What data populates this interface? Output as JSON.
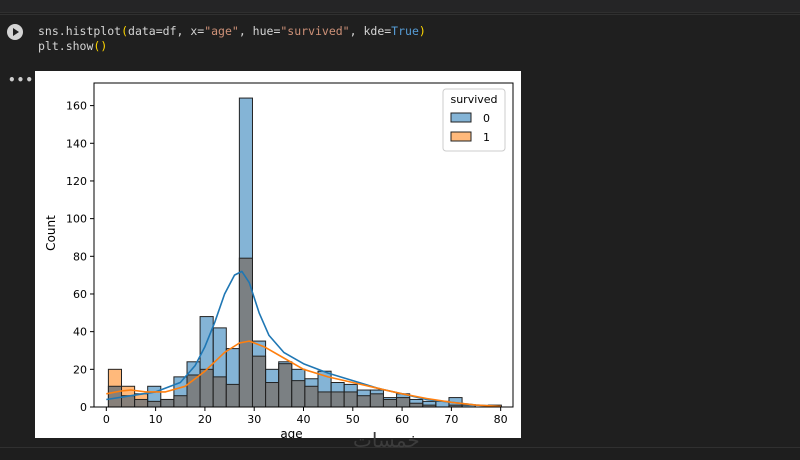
{
  "code": {
    "line1": {
      "fn": "sns.histplot",
      "open": "(",
      "a1": "data=df, x=",
      "s1": "\"age\"",
      "a2": ", hue=",
      "s2": "\"survived\"",
      "a3": ", kde=",
      "kw": "True",
      "close": ")"
    },
    "line2": {
      "fn": "plt.show",
      "parens": "()"
    }
  },
  "output_menu": "•••",
  "watermark": "خمسات",
  "chart_data": {
    "type": "histogram",
    "xlabel": "age",
    "ylabel": "Count",
    "xlim": [
      -2.5,
      82.5
    ],
    "ylim": [
      0,
      172
    ],
    "xticks": [
      0,
      10,
      20,
      30,
      40,
      50,
      60,
      70,
      80
    ],
    "yticks": [
      0,
      20,
      40,
      60,
      80,
      100,
      120,
      140,
      160
    ],
    "bin_edges": [
      0.42,
      3.08,
      5.74,
      8.39,
      11.05,
      13.71,
      16.37,
      19.02,
      21.68,
      24.34,
      26.99,
      29.65,
      32.31,
      34.97,
      37.62,
      40.28,
      42.94,
      45.6,
      48.25,
      50.91,
      53.57,
      56.22,
      58.88,
      61.54,
      64.2,
      66.85,
      69.51,
      72.17,
      74.83,
      77.48,
      80.14
    ],
    "legend": {
      "title": "survived",
      "placement": "top-right",
      "entries": [
        "0",
        "1"
      ]
    },
    "colors": {
      "0": "#1f77b4",
      "1": "#ff7f0e",
      "overlap": "#7a7a7a"
    },
    "series": [
      {
        "name": "0",
        "values": [
          11,
          6,
          4,
          11,
          4,
          16,
          24,
          48,
          42,
          31,
          164,
          35,
          20,
          24,
          20,
          15,
          19,
          13,
          12,
          9,
          9,
          5,
          7,
          4,
          3,
          3,
          5,
          1,
          0,
          0
        ]
      },
      {
        "name": "1",
        "values": [
          20,
          11,
          7,
          3,
          4,
          6,
          17,
          20,
          16,
          12,
          79,
          27,
          13,
          23,
          14,
          11,
          8,
          8,
          8,
          6,
          7,
          4,
          5,
          2,
          1,
          0,
          1,
          0,
          0,
          1
        ]
      }
    ],
    "kde": [
      {
        "name": "0",
        "x": [
          0,
          5,
          10,
          15,
          18,
          20,
          22,
          24,
          26,
          27.5,
          29,
          31,
          33,
          36,
          40,
          45,
          50,
          55,
          60,
          65,
          70,
          75,
          80
        ],
        "y": [
          4,
          6,
          8,
          13,
          22,
          32,
          45,
          60,
          70,
          72,
          66,
          50,
          38,
          29,
          23,
          18,
          14,
          10,
          7,
          4,
          2.5,
          1,
          0.3
        ]
      },
      {
        "name": "1",
        "x": [
          0,
          3,
          5,
          8,
          12,
          16,
          20,
          24,
          27,
          29,
          32,
          36,
          40,
          45,
          50,
          55,
          60,
          65,
          70,
          75,
          80
        ],
        "y": [
          7,
          8.5,
          9,
          8,
          8,
          11,
          19,
          29,
          34,
          35,
          32,
          26,
          20,
          16,
          13,
          10,
          7,
          4.5,
          2.5,
          1,
          0.3
        ]
      }
    ]
  }
}
